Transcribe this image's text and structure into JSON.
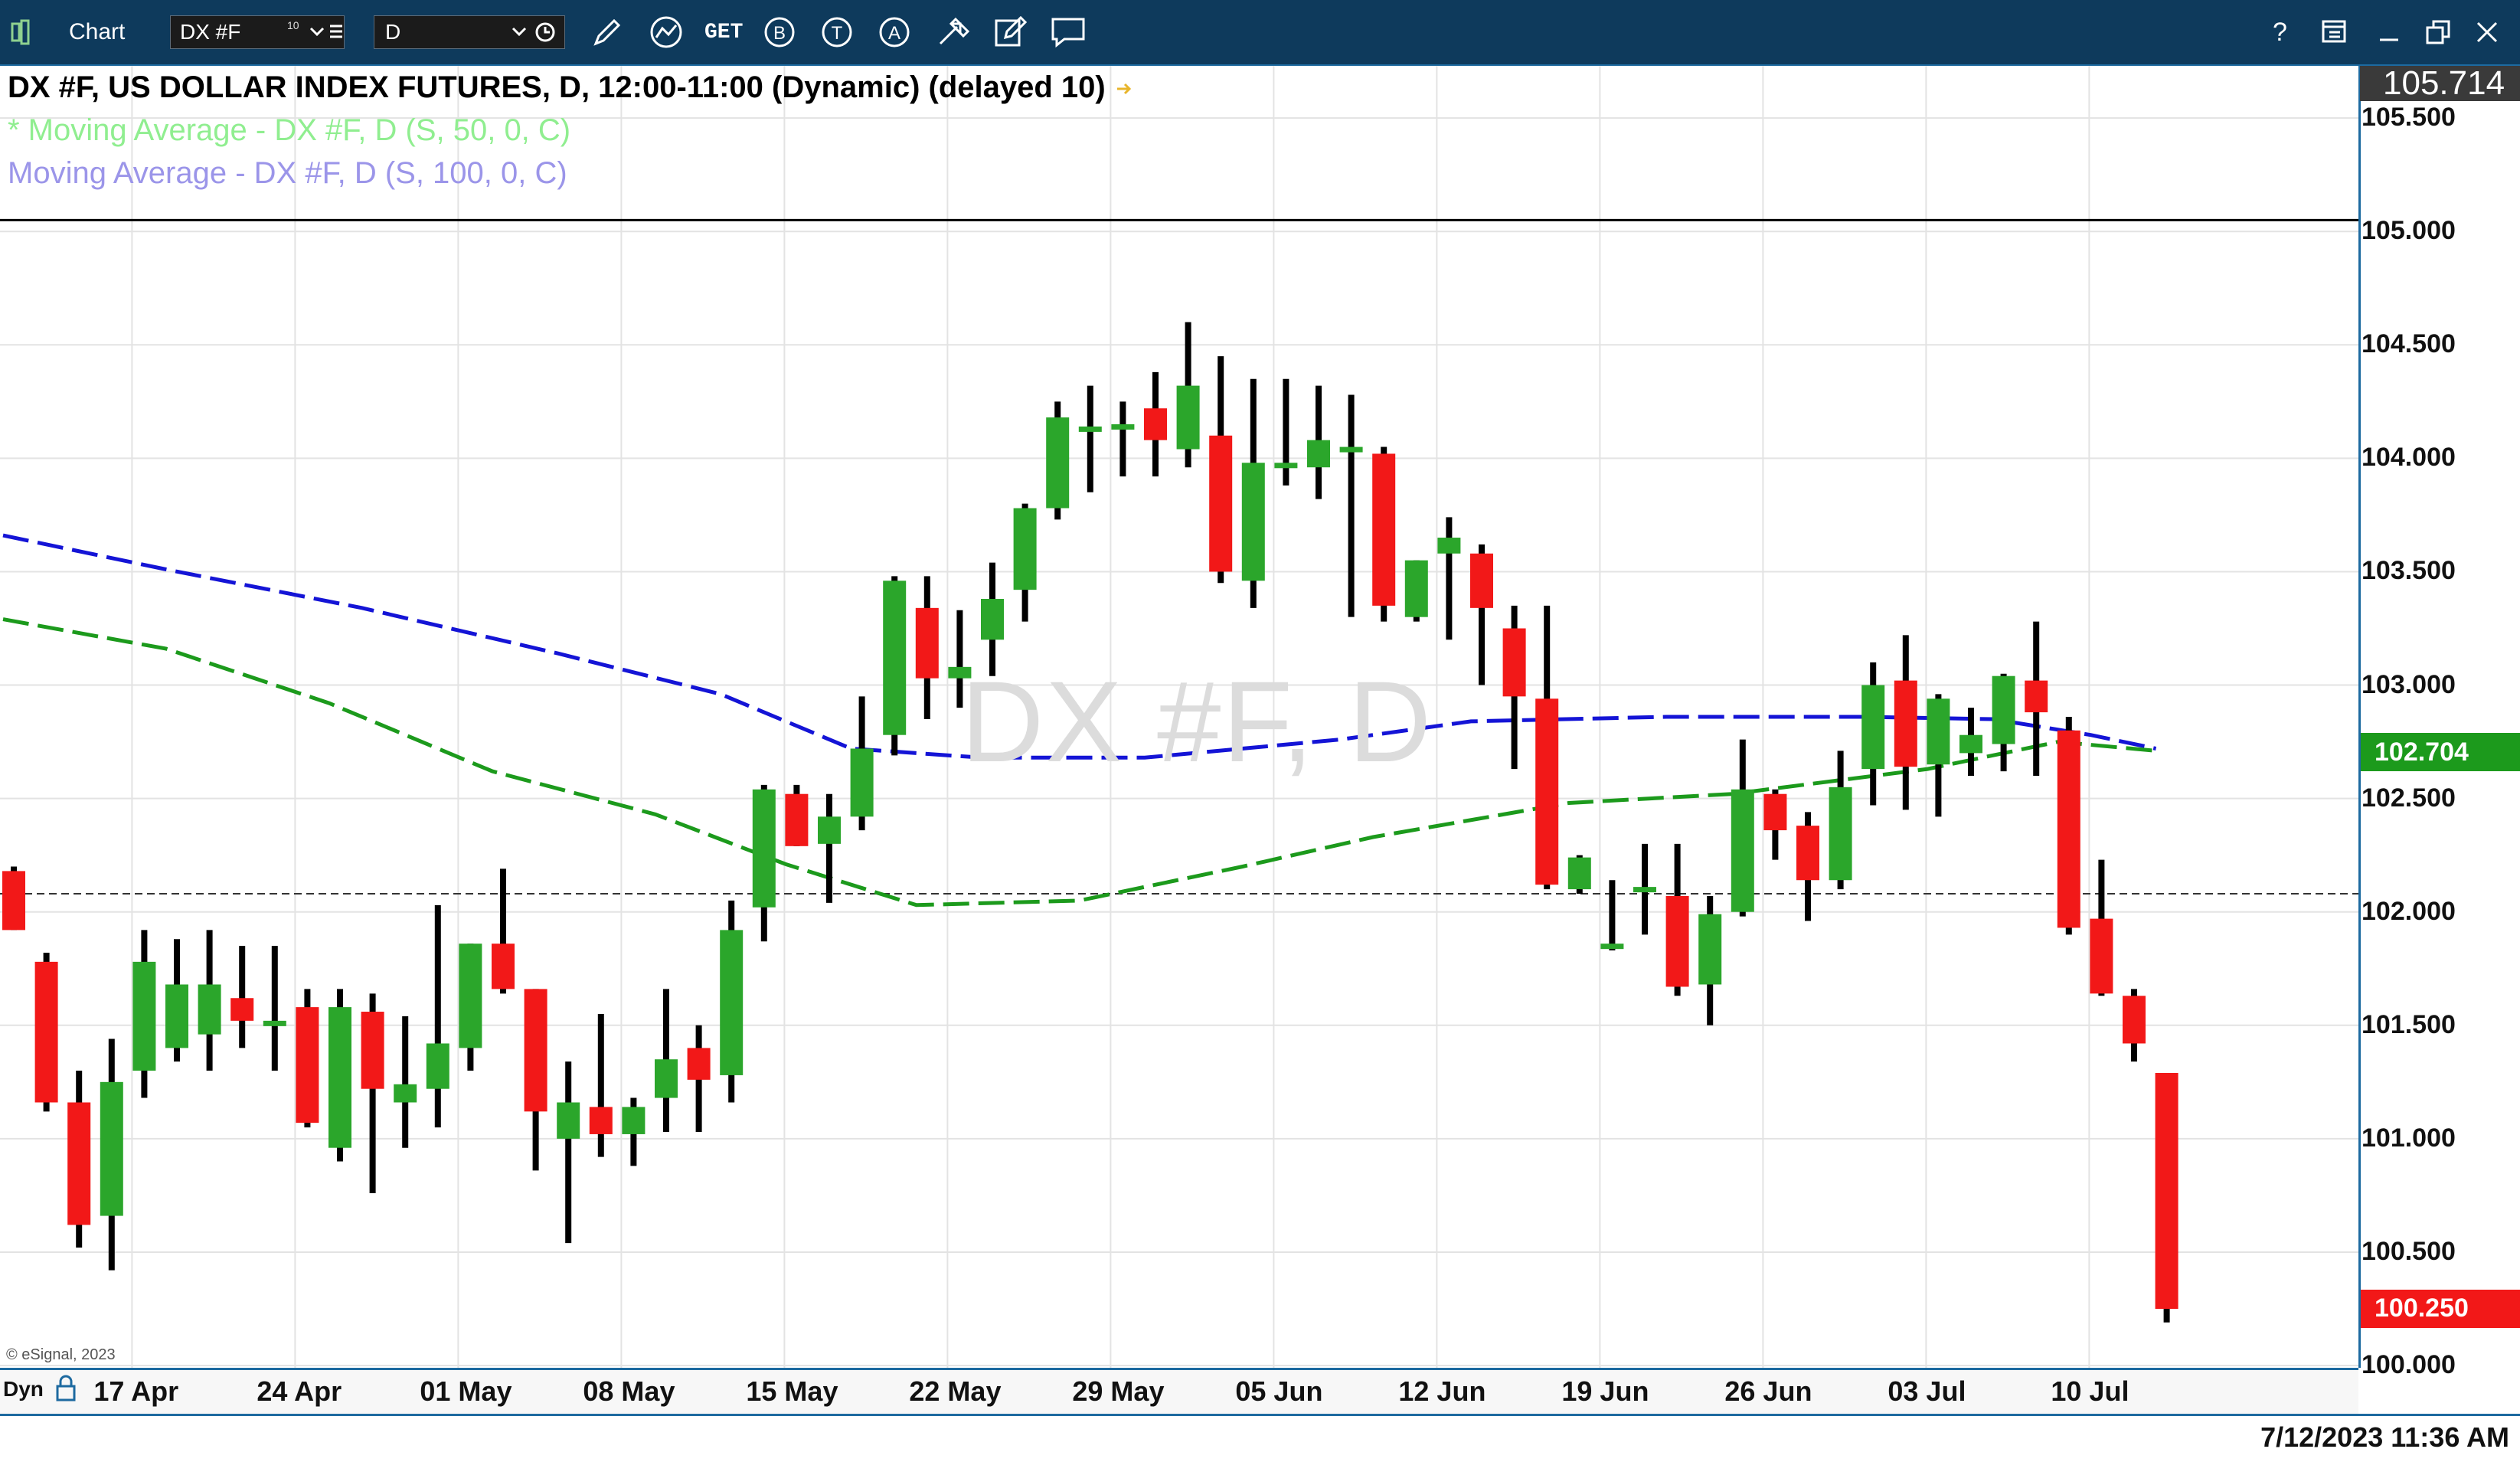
{
  "toolbar": {
    "app_label": "Chart",
    "symbol_value": "DX #F",
    "symbol_superscript": "10",
    "interval_value": "D",
    "get_label": "GET",
    "help_label": "?",
    "icons": [
      "layout-icon",
      "pencil-icon",
      "line-tool-icon",
      "get-icon",
      "b-circle-icon",
      "t-circle-icon",
      "a-circle-icon",
      "settings-arrows-icon",
      "edit-icon",
      "comment-icon",
      "help-icon",
      "window-icon",
      "minimize-icon",
      "restore-icon",
      "close-icon"
    ]
  },
  "legend": {
    "title": "DX #F, US DOLLAR INDEX FUTURES, D, 12:00-11:00 (Dynamic) (delayed 10)",
    "ma50": "* Moving Average - DX #F, D (S, 50, 0, C)",
    "ma100": "Moving Average - DX #F, D (S, 100, 0, C)"
  },
  "watermark": "DX #F, D",
  "copyright": "© eSignal, 2023",
  "date_axis": {
    "mode": "Dyn",
    "labels": [
      "17 Apr",
      "24 Apr",
      "01 May",
      "08 May",
      "15 May",
      "22 May",
      "29 May",
      "05 Jun",
      "12 Jun",
      "19 Jun",
      "26 Jun",
      "03 Jul",
      "10 Jul"
    ]
  },
  "timestamp": "7/12/2023 11:36 AM",
  "price_tags": {
    "top_partial": "105.714",
    "ma": "102.704",
    "last": "100.250"
  },
  "colors": {
    "up": "#2ba62b",
    "down": "#f21818",
    "ma50": "#1c9a1c",
    "ma100": "#1414d6",
    "axis_border": "#1d6aa0",
    "titlebar": "#0e3a5c"
  },
  "chart_data": {
    "type": "candlestick",
    "title": "DX #F, US DOLLAR INDEX FUTURES, D, 12:00-11:00 (Dynamic) (delayed 10)",
    "y_ticks": [
      "105.500",
      "105.000",
      "104.500",
      "104.000",
      "103.500",
      "103.000",
      "102.500",
      "102.000",
      "101.500",
      "101.000",
      "100.500",
      "100.000"
    ],
    "ylim": [
      99.99,
      105.73
    ],
    "reference_lines": [
      105.05,
      102.08
    ],
    "x_labels": [
      "17 Apr",
      "24 Apr",
      "01 May",
      "08 May",
      "15 May",
      "22 May",
      "29 May",
      "05 Jun",
      "12 Jun",
      "19 Jun",
      "26 Jun",
      "03 Jul",
      "10 Jul"
    ],
    "candles": [
      {
        "o": 102.18,
        "h": 102.2,
        "l": 101.92,
        "c": 101.92
      },
      {
        "o": 101.78,
        "h": 101.82,
        "l": 101.12,
        "c": 101.16
      },
      {
        "o": 101.16,
        "h": 101.3,
        "l": 100.52,
        "c": 100.62
      },
      {
        "o": 100.66,
        "h": 101.44,
        "l": 100.42,
        "c": 101.25
      },
      {
        "o": 101.3,
        "h": 101.92,
        "l": 101.18,
        "c": 101.78
      },
      {
        "o": 101.4,
        "h": 101.88,
        "l": 101.34,
        "c": 101.68
      },
      {
        "o": 101.46,
        "h": 101.92,
        "l": 101.3,
        "c": 101.68
      },
      {
        "o": 101.62,
        "h": 101.85,
        "l": 101.4,
        "c": 101.52
      },
      {
        "o": 101.5,
        "h": 101.85,
        "l": 101.3,
        "c": 101.52
      },
      {
        "o": 101.58,
        "h": 101.66,
        "l": 101.05,
        "c": 101.07
      },
      {
        "o": 100.96,
        "h": 101.66,
        "l": 100.9,
        "c": 101.58
      },
      {
        "o": 101.56,
        "h": 101.64,
        "l": 100.76,
        "c": 101.22
      },
      {
        "o": 101.16,
        "h": 101.54,
        "l": 100.96,
        "c": 101.24
      },
      {
        "o": 101.22,
        "h": 102.03,
        "l": 101.05,
        "c": 101.42
      },
      {
        "o": 101.4,
        "h": 101.86,
        "l": 101.3,
        "c": 101.86
      },
      {
        "o": 101.86,
        "h": 102.19,
        "l": 101.64,
        "c": 101.66
      },
      {
        "o": 101.66,
        "h": 101.66,
        "l": 100.86,
        "c": 101.12
      },
      {
        "o": 101.0,
        "h": 101.34,
        "l": 100.54,
        "c": 101.16
      },
      {
        "o": 101.14,
        "h": 101.55,
        "l": 100.92,
        "c": 101.02
      },
      {
        "o": 101.02,
        "h": 101.18,
        "l": 100.88,
        "c": 101.14
      },
      {
        "o": 101.18,
        "h": 101.66,
        "l": 101.03,
        "c": 101.35
      },
      {
        "o": 101.4,
        "h": 101.5,
        "l": 101.03,
        "c": 101.26
      },
      {
        "o": 101.28,
        "h": 102.05,
        "l": 101.16,
        "c": 101.92
      },
      {
        "o": 102.02,
        "h": 102.56,
        "l": 101.87,
        "c": 102.54
      },
      {
        "o": 102.52,
        "h": 102.56,
        "l": 102.29,
        "c": 102.29
      },
      {
        "o": 102.3,
        "h": 102.52,
        "l": 102.04,
        "c": 102.42
      },
      {
        "o": 102.42,
        "h": 102.95,
        "l": 102.36,
        "c": 102.72
      },
      {
        "o": 102.78,
        "h": 103.48,
        "l": 102.69,
        "c": 103.46
      },
      {
        "o": 103.34,
        "h": 103.48,
        "l": 102.85,
        "c": 103.03
      },
      {
        "o": 103.03,
        "h": 103.33,
        "l": 102.9,
        "c": 103.08
      },
      {
        "o": 103.2,
        "h": 103.54,
        "l": 103.04,
        "c": 103.38
      },
      {
        "o": 103.42,
        "h": 103.8,
        "l": 103.28,
        "c": 103.78
      },
      {
        "o": 103.78,
        "h": 104.25,
        "l": 103.73,
        "c": 104.18
      },
      {
        "o": 104.14,
        "h": 104.32,
        "l": 103.85,
        "c": 104.14
      },
      {
        "o": 104.15,
        "h": 104.25,
        "l": 103.92,
        "c": 104.15
      },
      {
        "o": 104.22,
        "h": 104.38,
        "l": 103.92,
        "c": 104.08
      },
      {
        "o": 104.04,
        "h": 104.6,
        "l": 103.96,
        "c": 104.32
      },
      {
        "o": 104.1,
        "h": 104.45,
        "l": 103.45,
        "c": 103.5
      },
      {
        "o": 103.46,
        "h": 104.35,
        "l": 103.34,
        "c": 103.98
      },
      {
        "o": 103.98,
        "h": 104.35,
        "l": 103.88,
        "c": 103.98
      },
      {
        "o": 103.96,
        "h": 104.32,
        "l": 103.82,
        "c": 104.08
      },
      {
        "o": 104.05,
        "h": 104.28,
        "l": 103.3,
        "c": 104.05
      },
      {
        "o": 104.02,
        "h": 104.05,
        "l": 103.28,
        "c": 103.35
      },
      {
        "o": 103.3,
        "h": 103.55,
        "l": 103.28,
        "c": 103.55
      },
      {
        "o": 103.58,
        "h": 103.74,
        "l": 103.2,
        "c": 103.65
      },
      {
        "o": 103.58,
        "h": 103.62,
        "l": 103.0,
        "c": 103.34
      },
      {
        "o": 103.25,
        "h": 103.35,
        "l": 102.63,
        "c": 102.95
      },
      {
        "o": 102.94,
        "h": 103.35,
        "l": 102.1,
        "c": 102.12
      },
      {
        "o": 102.1,
        "h": 102.25,
        "l": 102.08,
        "c": 102.24
      },
      {
        "o": 101.86,
        "h": 102.14,
        "l": 101.83,
        "c": 101.86
      },
      {
        "o": 102.09,
        "h": 102.3,
        "l": 101.9,
        "c": 102.11
      },
      {
        "o": 102.07,
        "h": 102.3,
        "l": 101.63,
        "c": 101.67
      },
      {
        "o": 101.68,
        "h": 102.07,
        "l": 101.5,
        "c": 101.99
      },
      {
        "o": 102.0,
        "h": 102.76,
        "l": 101.98,
        "c": 102.54
      },
      {
        "o": 102.52,
        "h": 102.54,
        "l": 102.23,
        "c": 102.36
      },
      {
        "o": 102.38,
        "h": 102.44,
        "l": 101.96,
        "c": 102.14
      },
      {
        "o": 102.14,
        "h": 102.71,
        "l": 102.1,
        "c": 102.55
      },
      {
        "o": 102.63,
        "h": 103.1,
        "l": 102.47,
        "c": 103.0
      },
      {
        "o": 103.02,
        "h": 103.22,
        "l": 102.45,
        "c": 102.64
      },
      {
        "o": 102.65,
        "h": 102.96,
        "l": 102.42,
        "c": 102.94
      },
      {
        "o": 102.7,
        "h": 102.9,
        "l": 102.6,
        "c": 102.78
      },
      {
        "o": 102.74,
        "h": 103.05,
        "l": 102.62,
        "c": 103.04
      },
      {
        "o": 103.02,
        "h": 103.28,
        "l": 102.6,
        "c": 102.88
      },
      {
        "o": 102.8,
        "h": 102.86,
        "l": 101.9,
        "c": 101.93
      },
      {
        "o": 101.97,
        "h": 102.23,
        "l": 101.63,
        "c": 101.64
      },
      {
        "o": 101.63,
        "h": 101.66,
        "l": 101.34,
        "c": 101.42
      },
      {
        "o": 101.29,
        "h": 101.29,
        "l": 100.19,
        "c": 100.25
      }
    ],
    "ma100_points": [
      [
        0,
        103.66
      ],
      [
        5,
        103.51
      ],
      [
        11,
        103.34
      ],
      [
        17,
        103.14
      ],
      [
        22,
        102.96
      ],
      [
        26,
        102.72
      ],
      [
        30,
        102.68
      ],
      [
        35,
        102.68
      ],
      [
        41,
        102.76
      ],
      [
        45,
        102.84
      ],
      [
        51,
        102.86
      ],
      [
        57,
        102.86
      ],
      [
        61,
        102.85
      ],
      [
        64,
        102.78
      ],
      [
        66,
        102.72
      ]
    ],
    "ma50_points": [
      [
        0,
        103.29
      ],
      [
        5,
        103.16
      ],
      [
        10,
        102.92
      ],
      [
        15,
        102.62
      ],
      [
        20,
        102.43
      ],
      [
        24,
        102.21
      ],
      [
        28,
        102.03
      ],
      [
        33,
        102.05
      ],
      [
        38,
        102.2
      ],
      [
        42,
        102.33
      ],
      [
        48,
        102.48
      ],
      [
        53,
        102.52
      ],
      [
        59,
        102.63
      ],
      [
        63,
        102.75
      ],
      [
        66,
        102.71
      ]
    ]
  }
}
